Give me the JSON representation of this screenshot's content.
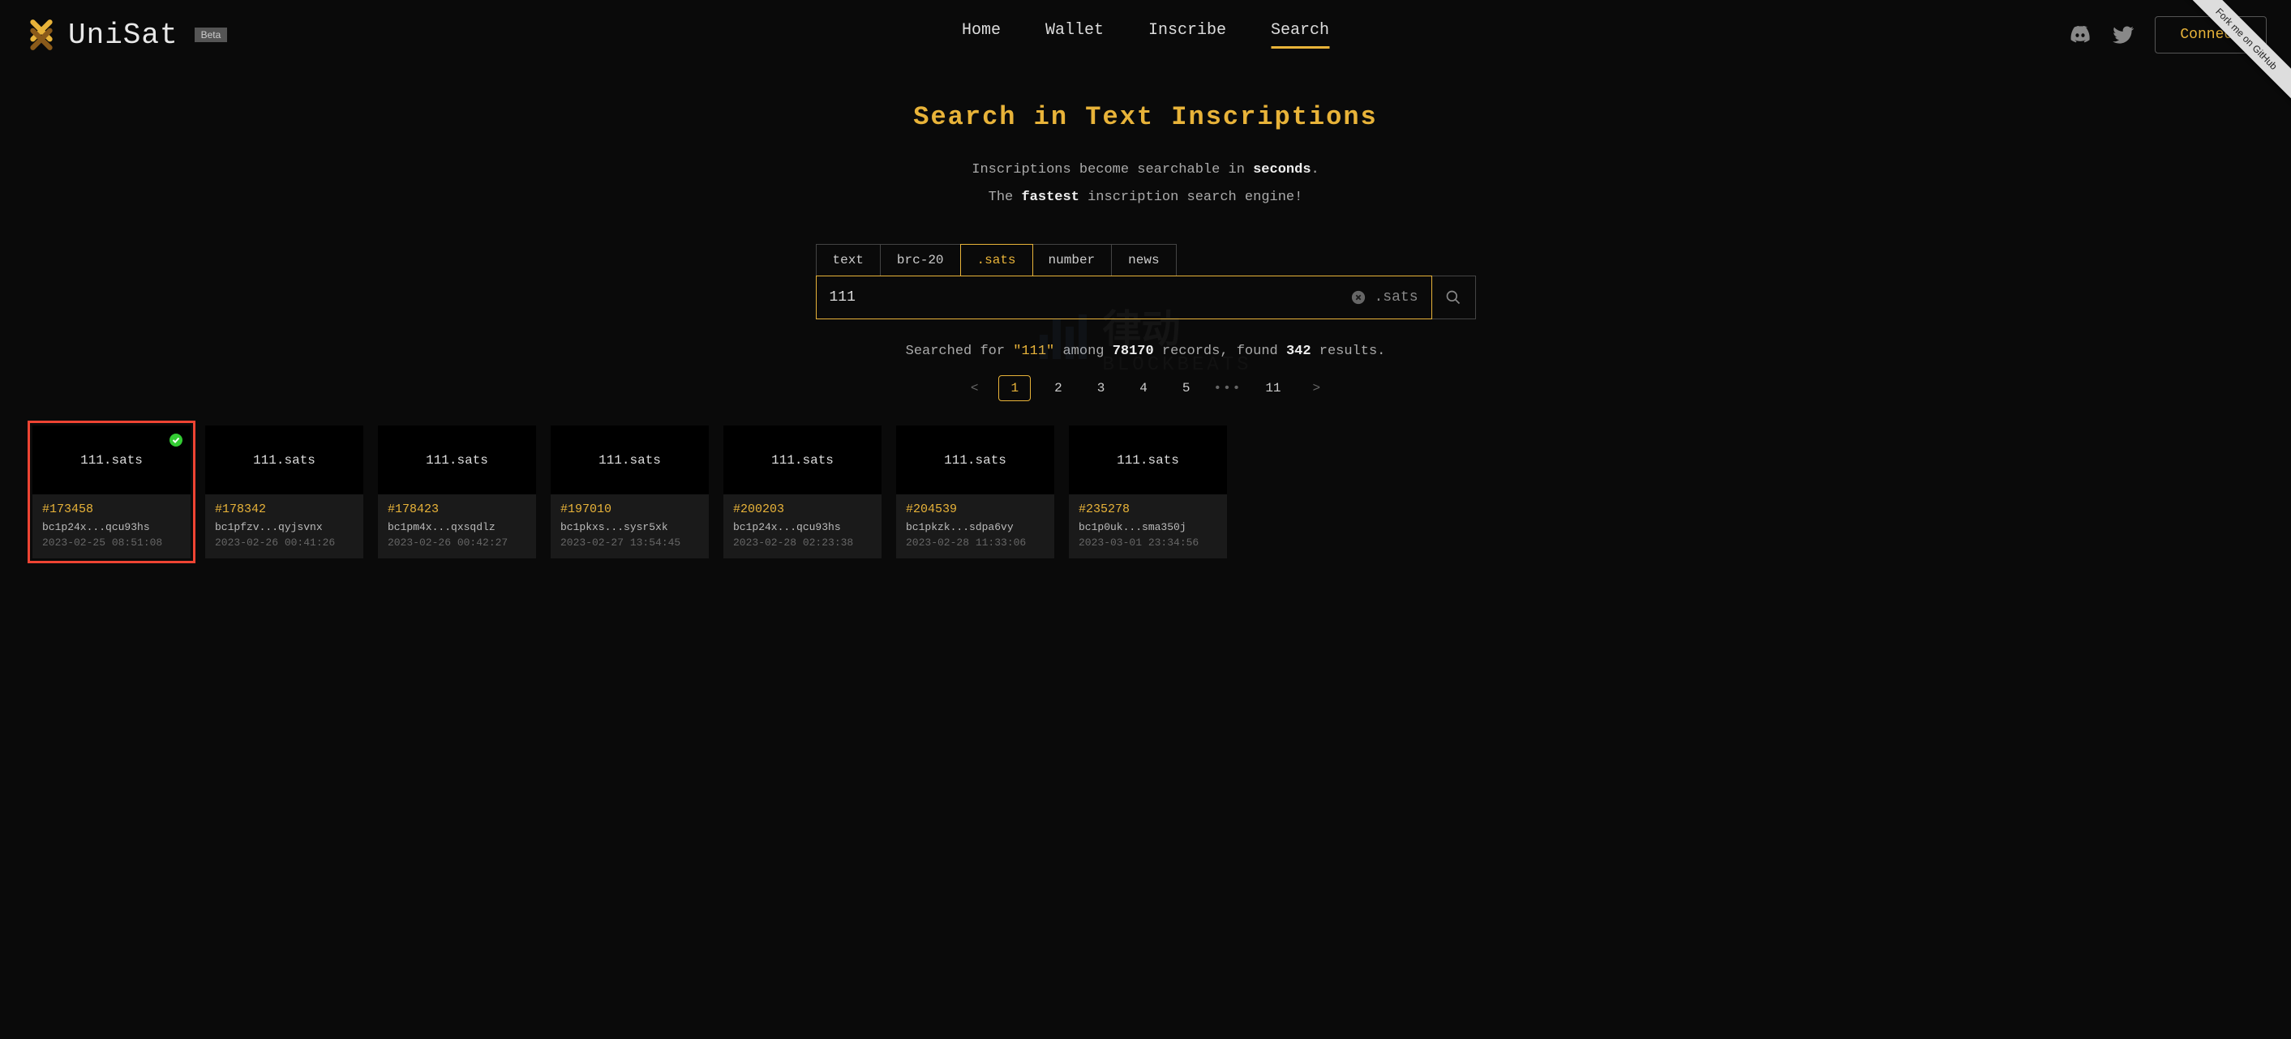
{
  "header": {
    "brand": "UniSat",
    "beta": "Beta",
    "nav": [
      "Home",
      "Wallet",
      "Inscribe",
      "Search"
    ],
    "active_nav_index": 3,
    "connect": "Connect",
    "github_ribbon": "Fork me on GitHub"
  },
  "hero": {
    "title": "Search in Text Inscriptions",
    "line1_pre": "Inscriptions become searchable in ",
    "line1_b": "seconds",
    "line1_post": ".",
    "line2_pre": "The ",
    "line2_b": "fastest",
    "line2_post": " inscription search engine!"
  },
  "tabs": [
    "text",
    "brc-20",
    ".sats",
    "number",
    "news"
  ],
  "active_tab_index": 2,
  "search": {
    "value": "111",
    "suffix": ".sats"
  },
  "results_summary": {
    "pre": "Searched for ",
    "query": "\"111\"",
    "mid1": " among ",
    "total": "78170",
    "mid2": " records, found ",
    "found": "342",
    "post": " results."
  },
  "pagination": {
    "pages": [
      "1",
      "2",
      "3",
      "4",
      "5"
    ],
    "last": "11",
    "active_index": 0
  },
  "cards": [
    {
      "name": "111.sats",
      "id": "#173458",
      "addr": "bc1p24x...qcu93hs",
      "date": "2023-02-25 08:51:08",
      "verified": true,
      "highlighted": true
    },
    {
      "name": "111.sats",
      "id": "#178342",
      "addr": "bc1pfzv...qyjsvnx",
      "date": "2023-02-26 00:41:26",
      "verified": false,
      "highlighted": false
    },
    {
      "name": "111.sats",
      "id": "#178423",
      "addr": "bc1pm4x...qxsqdlz",
      "date": "2023-02-26 00:42:27",
      "verified": false,
      "highlighted": false
    },
    {
      "name": "111.sats",
      "id": "#197010",
      "addr": "bc1pkxs...sysr5xk",
      "date": "2023-02-27 13:54:45",
      "verified": false,
      "highlighted": false
    },
    {
      "name": "111.sats",
      "id": "#200203",
      "addr": "bc1p24x...qcu93hs",
      "date": "2023-02-28 02:23:38",
      "verified": false,
      "highlighted": false
    },
    {
      "name": "111.sats",
      "id": "#204539",
      "addr": "bc1pkzk...sdpa6vy",
      "date": "2023-02-28 11:33:06",
      "verified": false,
      "highlighted": false
    },
    {
      "name": "111.sats",
      "id": "#235278",
      "addr": "bc1p0uk...sma350j",
      "date": "2023-03-01 23:34:56",
      "verified": false,
      "highlighted": false
    }
  ],
  "watermark": {
    "cn": "律动",
    "en": "BLOCKBEATS"
  }
}
